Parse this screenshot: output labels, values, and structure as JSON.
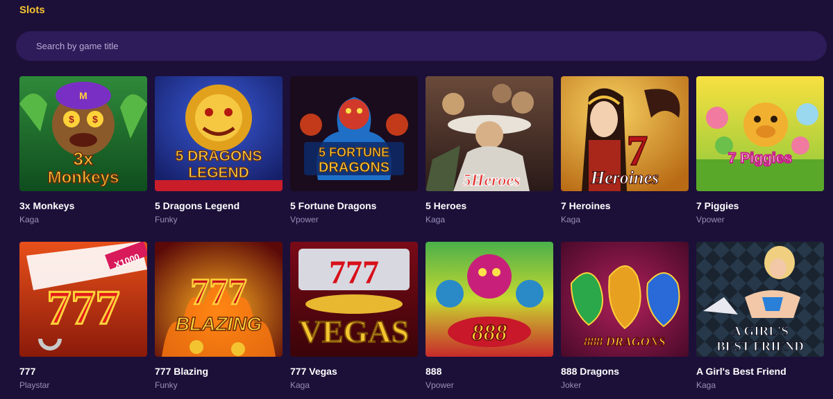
{
  "section": {
    "title": "Slots"
  },
  "search": {
    "placeholder": "Search by game title",
    "value": ""
  },
  "games": [
    {
      "name": "3x Monkeys",
      "provider": "Kaga",
      "art": [
        "3x",
        "Monkeys"
      ],
      "icon": "monkey-art-icon"
    },
    {
      "name": "5 Dragons Legend",
      "provider": "Funky",
      "art": [
        "5 DRAGONS",
        "LEGEND"
      ],
      "icon": "dragon-art-icon"
    },
    {
      "name": "5 Fortune Dragons",
      "provider": "Vpower",
      "art": [
        "5 FORTUNE",
        "DRAGONS"
      ],
      "icon": "dragon-art-icon"
    },
    {
      "name": "5 Heroes",
      "provider": "Kaga",
      "art": [
        "5Heroes"
      ],
      "icon": "warrior-art-icon"
    },
    {
      "name": "7 Heroines",
      "provider": "Kaga",
      "art": [
        "7",
        "Heroines"
      ],
      "icon": "heroine-art-icon"
    },
    {
      "name": "7 Piggies",
      "provider": "Vpower",
      "art": [
        "7 Piggies"
      ],
      "icon": "pig-art-icon"
    },
    {
      "name": "777",
      "provider": "Playstar",
      "art": [
        "777",
        "X1000"
      ],
      "icon": "sevens-art-icon"
    },
    {
      "name": "777 Blazing",
      "provider": "Funky",
      "art": [
        "777",
        "BLAZING"
      ],
      "icon": "sevens-art-icon"
    },
    {
      "name": "777 Vegas",
      "provider": "Kaga",
      "art": [
        "777",
        "VEGAS"
      ],
      "icon": "sevens-art-icon"
    },
    {
      "name": "888",
      "provider": "Vpower",
      "art": [
        "888"
      ],
      "icon": "dragon-art-icon"
    },
    {
      "name": "888 Dragons",
      "provider": "Joker",
      "art": [
        "888 DRAGONS"
      ],
      "icon": "dragon-art-icon"
    },
    {
      "name": "A Girl's Best Friend",
      "provider": "Kaga",
      "art": [
        "A GIRL'S",
        "BEST FRIEND"
      ],
      "icon": "woman-art-icon"
    }
  ]
}
